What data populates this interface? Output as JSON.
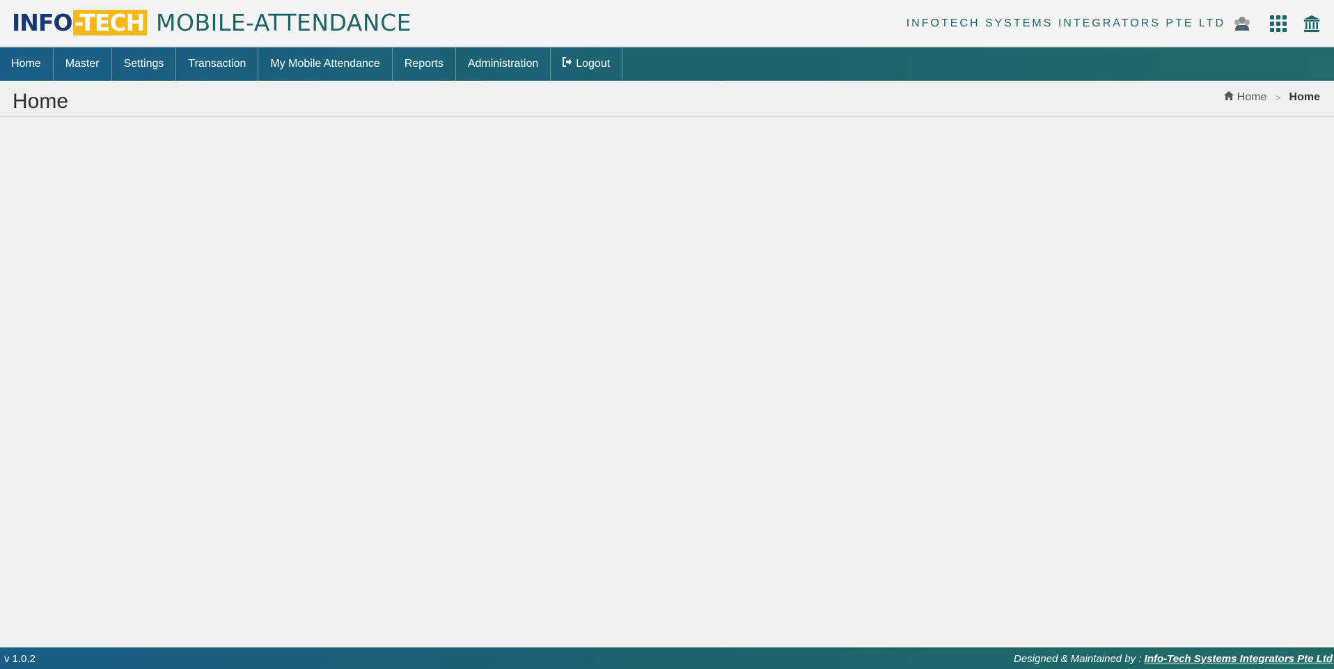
{
  "header": {
    "logo_left": "INFO",
    "logo_right": "-TECH",
    "app_title": "MOBILE-ATTENDANCE",
    "company": "INFOTECH SYSTEMS INTEGRATORS PTE LTD",
    "icons": [
      "users-icon",
      "apps-grid-icon",
      "bank-icon"
    ]
  },
  "nav": {
    "items": [
      {
        "label": "Home"
      },
      {
        "label": "Master"
      },
      {
        "label": "Settings"
      },
      {
        "label": "Transaction"
      },
      {
        "label": "My Mobile Attendance"
      },
      {
        "label": "Reports"
      },
      {
        "label": "Administration"
      },
      {
        "label": "Logout",
        "icon": "sign-out-icon"
      }
    ]
  },
  "page": {
    "title": "Home",
    "breadcrumb": {
      "home_label": "Home",
      "current": "Home"
    }
  },
  "footer": {
    "version": "v 1.0.2",
    "credit_prefix": "Designed & Maintained by : ",
    "credit_link": "Info-Tech Systems Integrators Pte Ltd"
  },
  "colors": {
    "brand_teal": "#1d6368",
    "logo_navy": "#16367a",
    "logo_yellow": "#f7b719",
    "nav_gradient_start": "#1a5f86",
    "nav_gradient_end": "#236b66"
  }
}
